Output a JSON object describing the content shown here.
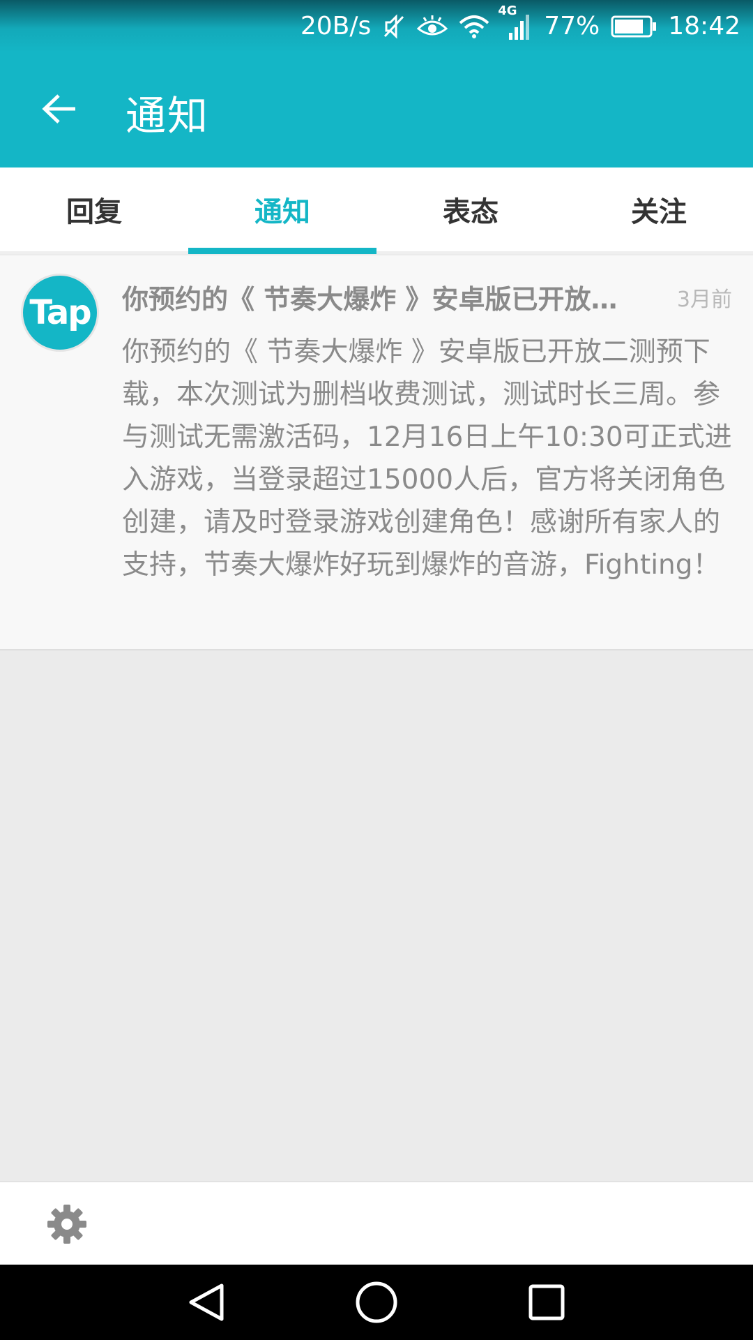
{
  "status_bar": {
    "speed": "20B/s",
    "network": "4G",
    "battery": "77%",
    "time": "18:42"
  },
  "app_bar": {
    "title": "通知",
    "back_icon": "arrow-left-icon"
  },
  "tabs": [
    {
      "label": "回复",
      "active": false
    },
    {
      "label": "通知",
      "active": true
    },
    {
      "label": "表态",
      "active": false
    },
    {
      "label": "关注",
      "active": false
    }
  ],
  "notification": {
    "avatar_text": "Tap",
    "title": "你预约的《 节奏大爆炸 》安卓版已开放二测预下载",
    "time": "3月前",
    "body": "你预约的《 节奏大爆炸 》安卓版已开放二测预下载，本次测试为删档收费测试，测试时长三周。参与测试无需激活码，12月16日上午10:30可正式进入游戏，当登录超过15000人后，官方将关闭角色创建，请及时登录游戏创建角色！感谢所有家人的支持，节奏大爆炸好玩到爆炸的音游，Fighting！"
  },
  "bottom_bar": {
    "settings_icon": "gear-icon"
  },
  "nav_bar": {
    "icons": [
      "back-triangle-icon",
      "home-circle-icon",
      "recents-square-icon"
    ]
  },
  "colors": {
    "accent": "#14b6c6",
    "text_muted": "#8a8a8a"
  }
}
